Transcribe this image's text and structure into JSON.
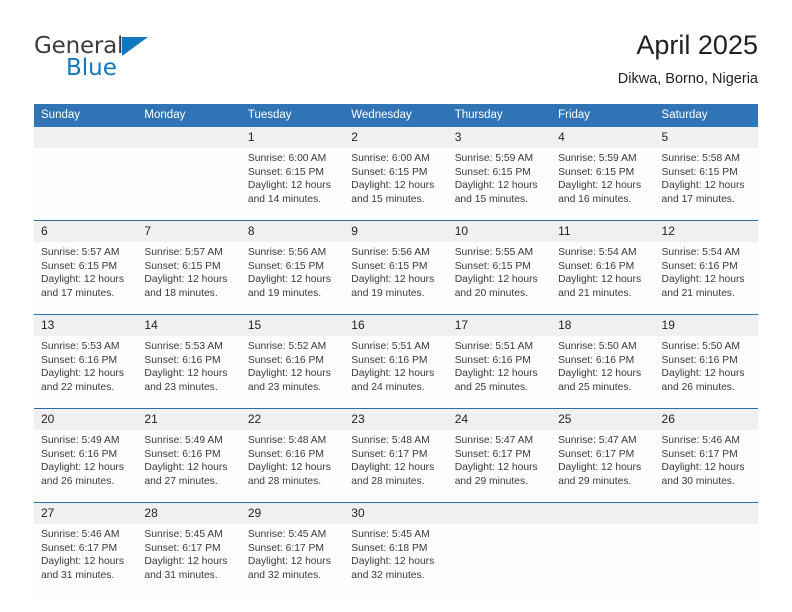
{
  "brand": {
    "name_part1": "General",
    "name_part2": "Blue",
    "triangle_color": "#1278be",
    "text_color": "#3c3c3c"
  },
  "header": {
    "title": "April 2025",
    "subtitle": "Dikwa, Borno, Nigeria"
  },
  "theme": {
    "header_blue": "#3174b5",
    "row_divider_blue": "#2e6da4",
    "date_band_gray": "#f0f0f0",
    "cell_background": "#fdfdfd"
  },
  "calendar": {
    "weekday_headers": [
      "Sunday",
      "Monday",
      "Tuesday",
      "Wednesday",
      "Thursday",
      "Friday",
      "Saturday"
    ],
    "weeks": [
      [
        {
          "day": "",
          "sunrise": "",
          "sunset": "",
          "daylight_line1": "",
          "daylight_line2": ""
        },
        {
          "day": "",
          "sunrise": "",
          "sunset": "",
          "daylight_line1": "",
          "daylight_line2": ""
        },
        {
          "day": "1",
          "sunrise": "Sunrise: 6:00 AM",
          "sunset": "Sunset: 6:15 PM",
          "daylight_line1": "Daylight: 12 hours",
          "daylight_line2": "and 14 minutes."
        },
        {
          "day": "2",
          "sunrise": "Sunrise: 6:00 AM",
          "sunset": "Sunset: 6:15 PM",
          "daylight_line1": "Daylight: 12 hours",
          "daylight_line2": "and 15 minutes."
        },
        {
          "day": "3",
          "sunrise": "Sunrise: 5:59 AM",
          "sunset": "Sunset: 6:15 PM",
          "daylight_line1": "Daylight: 12 hours",
          "daylight_line2": "and 15 minutes."
        },
        {
          "day": "4",
          "sunrise": "Sunrise: 5:59 AM",
          "sunset": "Sunset: 6:15 PM",
          "daylight_line1": "Daylight: 12 hours",
          "daylight_line2": "and 16 minutes."
        },
        {
          "day": "5",
          "sunrise": "Sunrise: 5:58 AM",
          "sunset": "Sunset: 6:15 PM",
          "daylight_line1": "Daylight: 12 hours",
          "daylight_line2": "and 17 minutes."
        }
      ],
      [
        {
          "day": "6",
          "sunrise": "Sunrise: 5:57 AM",
          "sunset": "Sunset: 6:15 PM",
          "daylight_line1": "Daylight: 12 hours",
          "daylight_line2": "and 17 minutes."
        },
        {
          "day": "7",
          "sunrise": "Sunrise: 5:57 AM",
          "sunset": "Sunset: 6:15 PM",
          "daylight_line1": "Daylight: 12 hours",
          "daylight_line2": "and 18 minutes."
        },
        {
          "day": "8",
          "sunrise": "Sunrise: 5:56 AM",
          "sunset": "Sunset: 6:15 PM",
          "daylight_line1": "Daylight: 12 hours",
          "daylight_line2": "and 19 minutes."
        },
        {
          "day": "9",
          "sunrise": "Sunrise: 5:56 AM",
          "sunset": "Sunset: 6:15 PM",
          "daylight_line1": "Daylight: 12 hours",
          "daylight_line2": "and 19 minutes."
        },
        {
          "day": "10",
          "sunrise": "Sunrise: 5:55 AM",
          "sunset": "Sunset: 6:15 PM",
          "daylight_line1": "Daylight: 12 hours",
          "daylight_line2": "and 20 minutes."
        },
        {
          "day": "11",
          "sunrise": "Sunrise: 5:54 AM",
          "sunset": "Sunset: 6:16 PM",
          "daylight_line1": "Daylight: 12 hours",
          "daylight_line2": "and 21 minutes."
        },
        {
          "day": "12",
          "sunrise": "Sunrise: 5:54 AM",
          "sunset": "Sunset: 6:16 PM",
          "daylight_line1": "Daylight: 12 hours",
          "daylight_line2": "and 21 minutes."
        }
      ],
      [
        {
          "day": "13",
          "sunrise": "Sunrise: 5:53 AM",
          "sunset": "Sunset: 6:16 PM",
          "daylight_line1": "Daylight: 12 hours",
          "daylight_line2": "and 22 minutes."
        },
        {
          "day": "14",
          "sunrise": "Sunrise: 5:53 AM",
          "sunset": "Sunset: 6:16 PM",
          "daylight_line1": "Daylight: 12 hours",
          "daylight_line2": "and 23 minutes."
        },
        {
          "day": "15",
          "sunrise": "Sunrise: 5:52 AM",
          "sunset": "Sunset: 6:16 PM",
          "daylight_line1": "Daylight: 12 hours",
          "daylight_line2": "and 23 minutes."
        },
        {
          "day": "16",
          "sunrise": "Sunrise: 5:51 AM",
          "sunset": "Sunset: 6:16 PM",
          "daylight_line1": "Daylight: 12 hours",
          "daylight_line2": "and 24 minutes."
        },
        {
          "day": "17",
          "sunrise": "Sunrise: 5:51 AM",
          "sunset": "Sunset: 6:16 PM",
          "daylight_line1": "Daylight: 12 hours",
          "daylight_line2": "and 25 minutes."
        },
        {
          "day": "18",
          "sunrise": "Sunrise: 5:50 AM",
          "sunset": "Sunset: 6:16 PM",
          "daylight_line1": "Daylight: 12 hours",
          "daylight_line2": "and 25 minutes."
        },
        {
          "day": "19",
          "sunrise": "Sunrise: 5:50 AM",
          "sunset": "Sunset: 6:16 PM",
          "daylight_line1": "Daylight: 12 hours",
          "daylight_line2": "and 26 minutes."
        }
      ],
      [
        {
          "day": "20",
          "sunrise": "Sunrise: 5:49 AM",
          "sunset": "Sunset: 6:16 PM",
          "daylight_line1": "Daylight: 12 hours",
          "daylight_line2": "and 26 minutes."
        },
        {
          "day": "21",
          "sunrise": "Sunrise: 5:49 AM",
          "sunset": "Sunset: 6:16 PM",
          "daylight_line1": "Daylight: 12 hours",
          "daylight_line2": "and 27 minutes."
        },
        {
          "day": "22",
          "sunrise": "Sunrise: 5:48 AM",
          "sunset": "Sunset: 6:16 PM",
          "daylight_line1": "Daylight: 12 hours",
          "daylight_line2": "and 28 minutes."
        },
        {
          "day": "23",
          "sunrise": "Sunrise: 5:48 AM",
          "sunset": "Sunset: 6:17 PM",
          "daylight_line1": "Daylight: 12 hours",
          "daylight_line2": "and 28 minutes."
        },
        {
          "day": "24",
          "sunrise": "Sunrise: 5:47 AM",
          "sunset": "Sunset: 6:17 PM",
          "daylight_line1": "Daylight: 12 hours",
          "daylight_line2": "and 29 minutes."
        },
        {
          "day": "25",
          "sunrise": "Sunrise: 5:47 AM",
          "sunset": "Sunset: 6:17 PM",
          "daylight_line1": "Daylight: 12 hours",
          "daylight_line2": "and 29 minutes."
        },
        {
          "day": "26",
          "sunrise": "Sunrise: 5:46 AM",
          "sunset": "Sunset: 6:17 PM",
          "daylight_line1": "Daylight: 12 hours",
          "daylight_line2": "and 30 minutes."
        }
      ],
      [
        {
          "day": "27",
          "sunrise": "Sunrise: 5:46 AM",
          "sunset": "Sunset: 6:17 PM",
          "daylight_line1": "Daylight: 12 hours",
          "daylight_line2": "and 31 minutes."
        },
        {
          "day": "28",
          "sunrise": "Sunrise: 5:45 AM",
          "sunset": "Sunset: 6:17 PM",
          "daylight_line1": "Daylight: 12 hours",
          "daylight_line2": "and 31 minutes."
        },
        {
          "day": "29",
          "sunrise": "Sunrise: 5:45 AM",
          "sunset": "Sunset: 6:17 PM",
          "daylight_line1": "Daylight: 12 hours",
          "daylight_line2": "and 32 minutes."
        },
        {
          "day": "30",
          "sunrise": "Sunrise: 5:45 AM",
          "sunset": "Sunset: 6:18 PM",
          "daylight_line1": "Daylight: 12 hours",
          "daylight_line2": "and 32 minutes."
        },
        {
          "day": "",
          "sunrise": "",
          "sunset": "",
          "daylight_line1": "",
          "daylight_line2": ""
        },
        {
          "day": "",
          "sunrise": "",
          "sunset": "",
          "daylight_line1": "",
          "daylight_line2": ""
        },
        {
          "day": "",
          "sunrise": "",
          "sunset": "",
          "daylight_line1": "",
          "daylight_line2": ""
        }
      ]
    ]
  }
}
